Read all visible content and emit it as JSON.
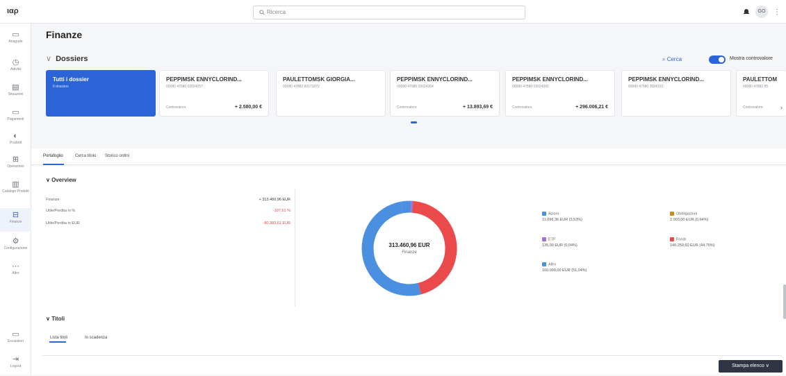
{
  "app": {
    "logo": "ιαρ"
  },
  "topbar": {
    "search_placeholder": "Ricerca",
    "avatar_initials": "GO"
  },
  "sidebar": {
    "items": [
      {
        "label": "Anagrafe",
        "icon": "folder-icon"
      },
      {
        "label": "Attività",
        "icon": "clock-icon"
      },
      {
        "label": "Situazioni",
        "icon": "list-icon"
      },
      {
        "label": "Pagamenti",
        "icon": "card-icon"
      },
      {
        "label": "Prodotti",
        "icon": "product-icon"
      },
      {
        "label": "Operazioni",
        "icon": "operations-icon"
      },
      {
        "label": "Catalogo Prodotti",
        "icon": "catalog-icon"
      },
      {
        "label": "Finanze",
        "icon": "finance-icon"
      },
      {
        "label": "Configurazione",
        "icon": "gear-icon"
      },
      {
        "label": "Altro",
        "icon": "more-icon"
      }
    ],
    "bottom": [
      {
        "label": "Escalation",
        "icon": "monitor-icon"
      },
      {
        "label": "Logout",
        "icon": "logout-icon"
      }
    ]
  },
  "page": {
    "title": "Finanze"
  },
  "dossiers": {
    "heading": "Dossiers",
    "search_label": "Cerca",
    "toggle_label": "Mostra controvalore",
    "toggle_on": true,
    "cards": [
      {
        "name": "Tutti i dossier",
        "sub": "6 dossiers",
        "label": "",
        "amount": "",
        "selected": true
      },
      {
        "name": "PEPPIMSK ENNYCLORIND...",
        "sub": "00080 47580 02024257",
        "label": "Controvalore",
        "amount": "+ 2.580,00 €",
        "selected": false
      },
      {
        "name": "PAULETTOMSK GIORGIA...",
        "sub": "00080 47882 83173272",
        "label": "",
        "amount": "",
        "selected": false
      },
      {
        "name": "PEPPIMSK ENNYCLORIND...",
        "sub": "00080 47580 02024264",
        "label": "Controvalore",
        "amount": "+ 13.893,69 €",
        "selected": false
      },
      {
        "name": "PEPPIMSK ENNYCLORIND...",
        "sub": "00080 47580 02024265",
        "label": "Controvalore",
        "amount": "+ 296.006,21 €",
        "selected": false
      },
      {
        "name": "PEPPIMSK ENNYCLORIND...",
        "sub": "00080 47580 2024310",
        "label": "",
        "amount": "",
        "selected": false
      },
      {
        "name": "PAULETTOM",
        "sub": "00080 47882 85",
        "label": "Controvalore",
        "amount": "",
        "selected": false
      }
    ]
  },
  "tabs": [
    "Portafoglio",
    "Cerca titolo",
    "Storico ordini"
  ],
  "overview": {
    "heading": "Overview",
    "rows": [
      {
        "label": "Finanze",
        "value": "+ 313.460,96 EUR",
        "negative": false
      },
      {
        "label": "Utile/Perdita in %",
        "value": "-107,61 %",
        "negative": true
      },
      {
        "label": "Utile/Perdita in EUR",
        "value": "-80.383,61 EUR",
        "negative": true
      }
    ],
    "donut": {
      "center_value": "313.460,96 EUR",
      "center_label": "Finanze"
    },
    "legend": [
      {
        "name": "Azioni",
        "value": "11.096,36 EUR (3,53%)",
        "color": "#4a8fe0"
      },
      {
        "name": "Obbligazioni",
        "value": "2.003,00 EUR (0,64%)",
        "color": "#c98a1e"
      },
      {
        "name": "ETF",
        "value": "135,00 EUR (0,04%)",
        "color": "#a070d8"
      },
      {
        "name": "Fondi",
        "value": "140.259,60 EUR (44,75%)",
        "color": "#ea4a4a"
      },
      {
        "name": "Altro",
        "value": "160.000,00 EUR (51,04%)",
        "color": "#4a8fe0"
      }
    ]
  },
  "chart_data": {
    "type": "pie",
    "categories": [
      "Azioni",
      "Obbligazioni",
      "ETF",
      "Fondi",
      "Altro"
    ],
    "values": [
      3.53,
      0.64,
      0.04,
      44.75,
      51.04
    ],
    "colors": [
      "#4a8fe0",
      "#c98a1e",
      "#a070d8",
      "#ea4a4a",
      "#4a8fe0"
    ]
  },
  "titoli": {
    "heading": "Titoli",
    "subtabs": [
      "Lista titoli",
      "In scadenza"
    ]
  },
  "footer": {
    "print_label": "Stampa elenco"
  }
}
